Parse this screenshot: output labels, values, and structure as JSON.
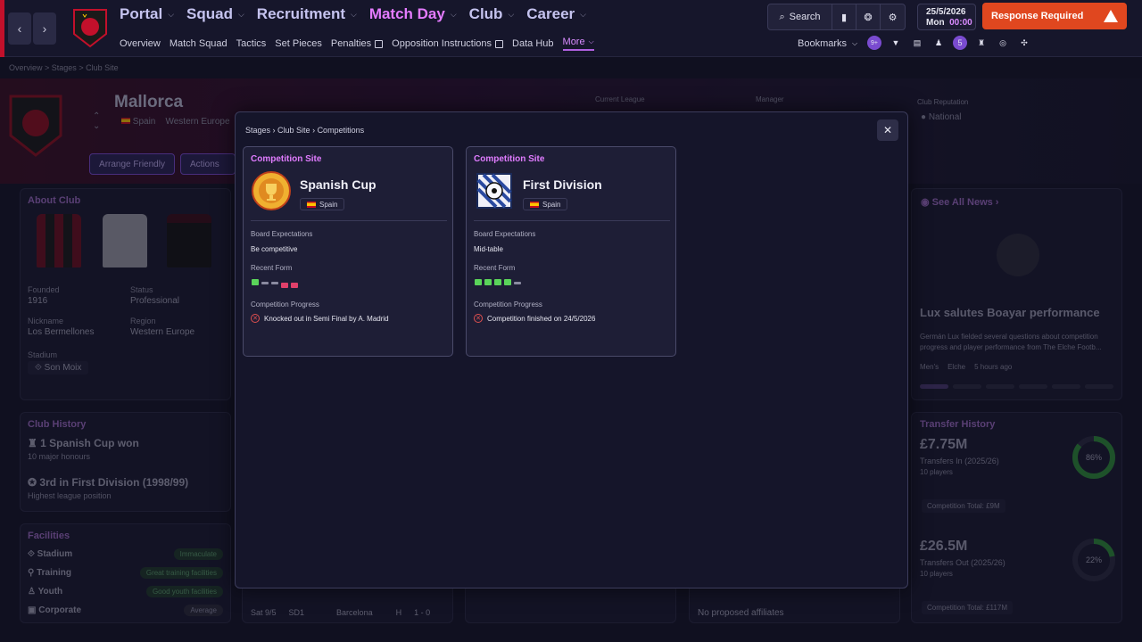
{
  "topbar": {
    "main_nav": [
      {
        "label": "Portal",
        "active": false
      },
      {
        "label": "Squad",
        "active": false
      },
      {
        "label": "Recruitment",
        "active": false
      },
      {
        "label": "Match Day",
        "active": true
      },
      {
        "label": "Club",
        "active": false
      },
      {
        "label": "Career",
        "active": false
      }
    ],
    "sub_nav": [
      "Overview",
      "Match Squad",
      "Tactics",
      "Set Pieces",
      "Penalties",
      "Opposition Instructions",
      "Data Hub",
      "More"
    ],
    "search_label": "Search",
    "date": "25/5/2026",
    "day": "Mon",
    "time": "00:00",
    "response_label": "Response Required",
    "bookmarks_label": "Bookmarks",
    "badge_a": "9+",
    "badge_b": "5"
  },
  "breadcrumb": [
    "Overview",
    "Stages",
    "Club Site"
  ],
  "club": {
    "name": "Mallorca",
    "nation": "Spain",
    "region_short": "Western Europe",
    "current_league_label": "Current League",
    "manager_label": "Manager",
    "reputation_label": "Club Reputation",
    "reputation": "National",
    "arrange_friendly": "Arrange Friendly",
    "actions": "Actions"
  },
  "about": {
    "title": "About Club",
    "founded_label": "Founded",
    "founded": "1916",
    "status_label": "Status",
    "status": "Professional",
    "nickname_label": "Nickname",
    "nickname": "Los Bermellones",
    "region_label": "Region",
    "region": "Western Europe",
    "stadium_label": "Stadium",
    "stadium": "Son Moix"
  },
  "history": {
    "title": "Club History",
    "item1": "1 Spanish Cup won",
    "item1_sub": "10  major honours",
    "item2": "3rd in First Division (1998/99)",
    "item2_sub": "Highest league position"
  },
  "facilities": {
    "title": "Facilities",
    "rows": [
      {
        "label": "Stadium",
        "value": "Immaculate"
      },
      {
        "label": "Training",
        "value": "Great training facilities"
      },
      {
        "label": "Youth",
        "value": "Good youth facilities"
      },
      {
        "label": "Corporate",
        "value": "Average"
      }
    ]
  },
  "fixture": {
    "date": "Sat 9/5",
    "comp": "SD1",
    "opponent": "Barcelona",
    "venue": "H",
    "score": "1 - 0"
  },
  "affiliates_text": "No proposed affiliates",
  "news": {
    "see_all": "See All News",
    "headline": "Lux salutes Boayar performance",
    "body": "Germán Lux fielded several questions about competition progress and player performance from The Elche Footb...",
    "tag1": "Men's",
    "tag2": "Elche",
    "ago": "5 hours ago"
  },
  "transfers": {
    "title": "Transfer History",
    "in_value": "£7.75M",
    "in_label": "Transfers In (2025/26)",
    "in_players": "10 players",
    "in_pct": "86%",
    "in_fraction": 0.86,
    "in_total": "Competition Total:  £9M",
    "out_value": "£26.5M",
    "out_label": "Transfers Out (2025/26)",
    "out_players": "10 players",
    "out_pct": "22%",
    "out_fraction": 0.22,
    "out_total": "Competition Total:  £117M"
  },
  "modal": {
    "crumbs": [
      "Stages",
      "Club Site",
      "Competitions"
    ],
    "cards": [
      {
        "title": "Competition Site",
        "name": "Spanish Cup",
        "nation": "Spain",
        "expect_label": "Board Expectations",
        "expectation": "Be competitive",
        "form_label": "Recent Form",
        "form": [
          "W",
          "D",
          "D",
          "L",
          "L"
        ],
        "progress_label": "Competition Progress",
        "progress": "Knocked out in Semi Final by A. Madrid"
      },
      {
        "title": "Competition Site",
        "name": "First Division",
        "nation": "Spain",
        "expect_label": "Board Expectations",
        "expectation": "Mid-table",
        "form_label": "Recent Form",
        "form": [
          "W",
          "W",
          "W",
          "W",
          "D"
        ],
        "progress_label": "Competition Progress",
        "progress": "Competition finished on 24/5/2026"
      }
    ]
  },
  "colors": {
    "accent": "#e07cff",
    "win": "#5ad45a",
    "draw": "#8a8aa0",
    "loss": "#e0406a",
    "alert": "#e0471f"
  }
}
